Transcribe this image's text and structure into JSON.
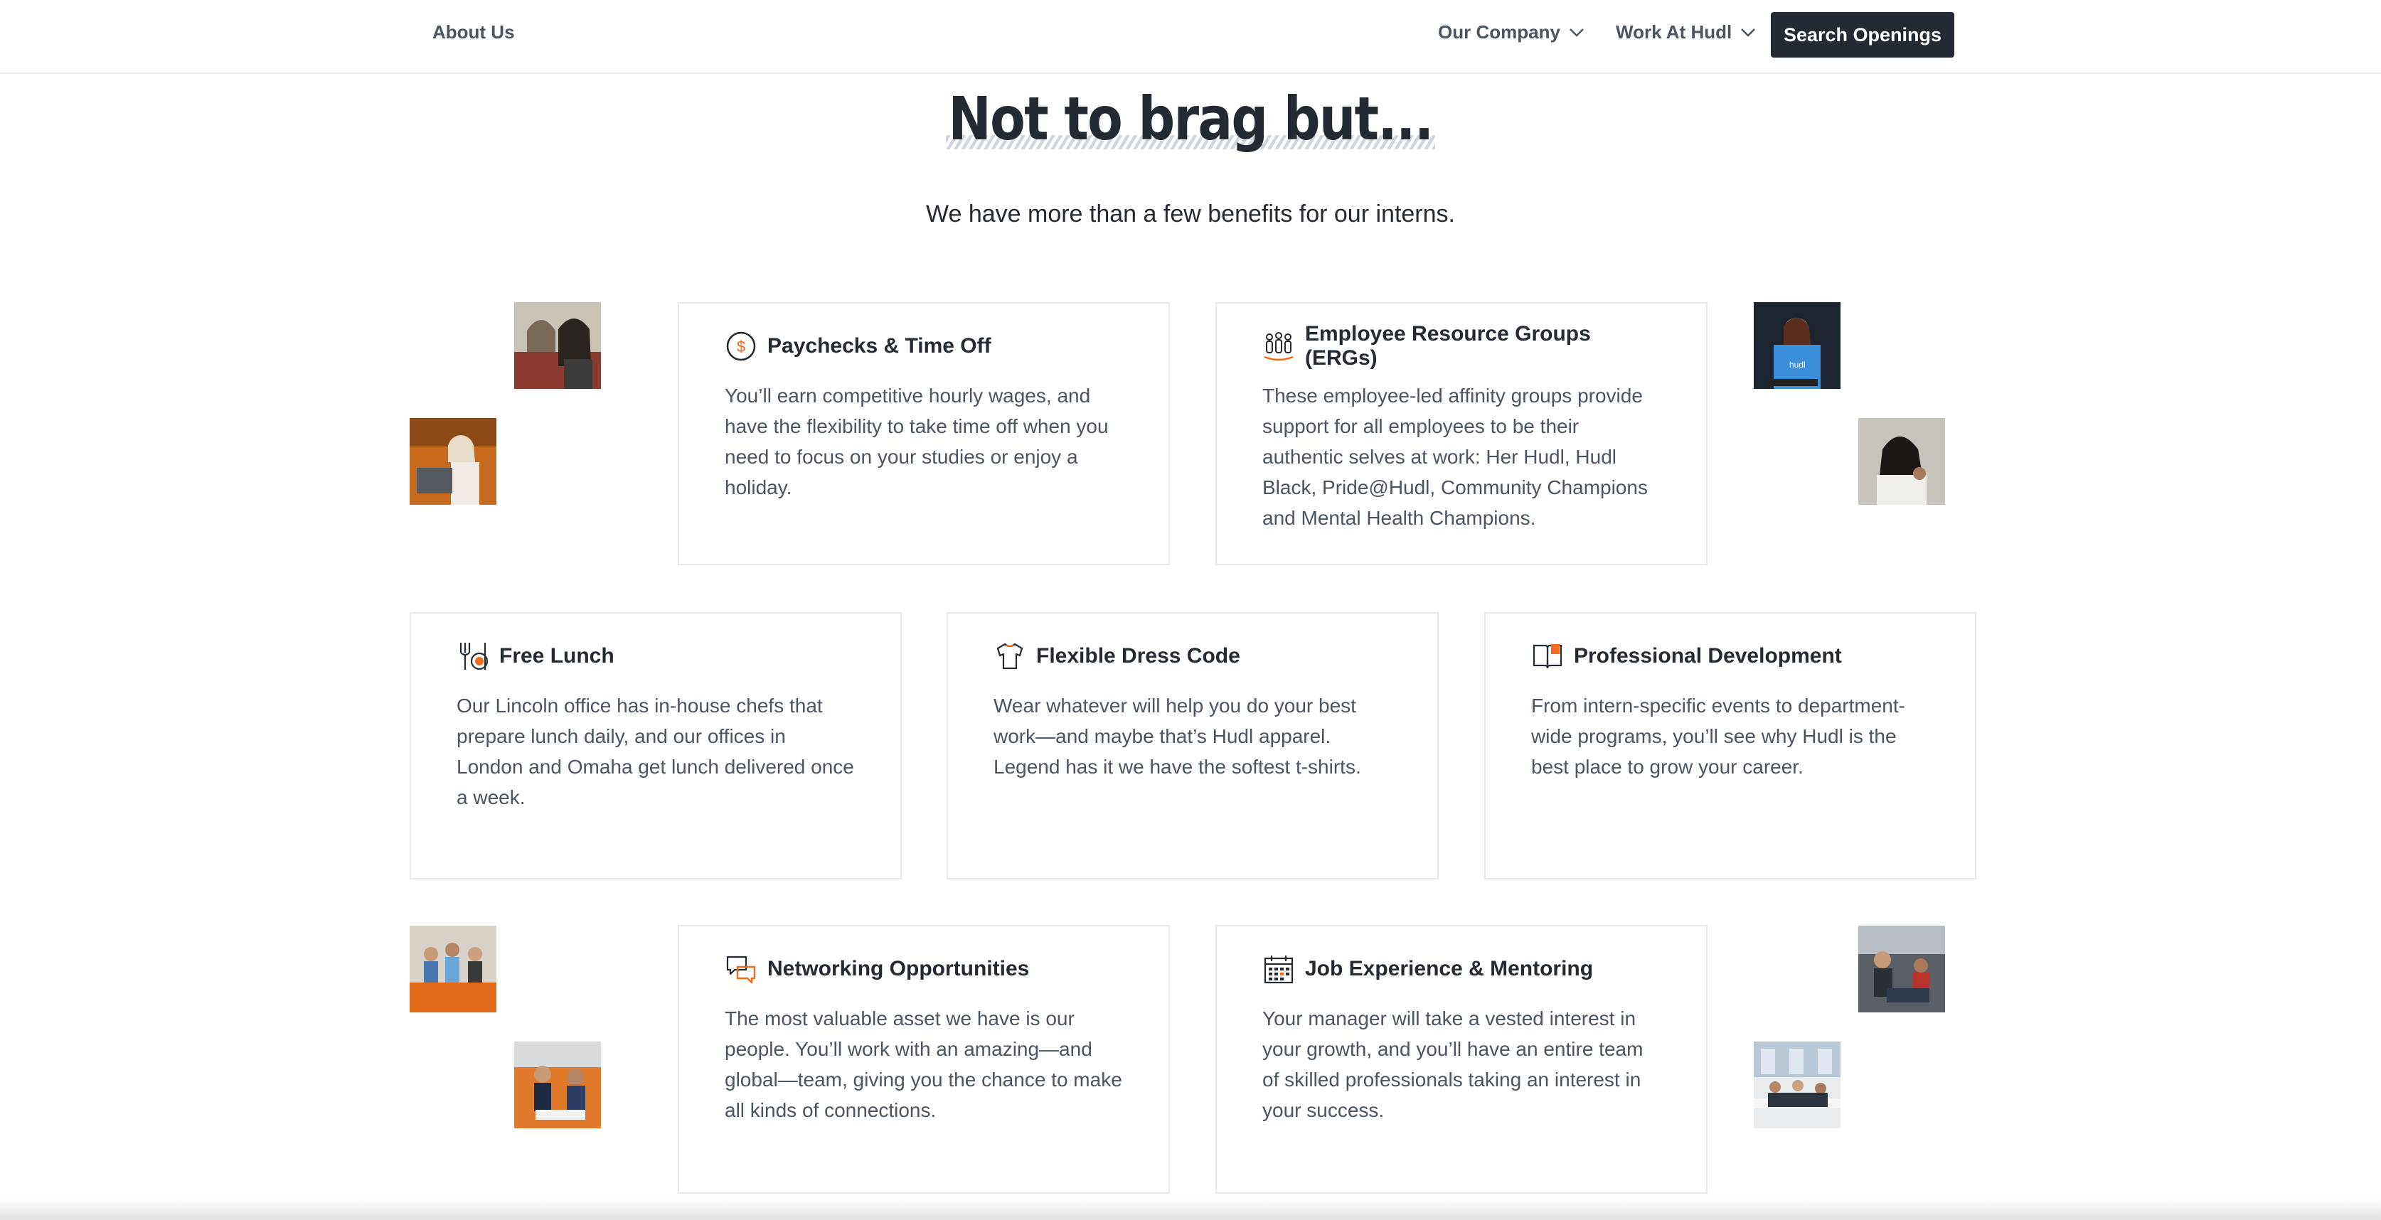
{
  "nav": {
    "about": "About Us",
    "company": "Our Company",
    "work": "Work At Hudl",
    "search_button": "Search Openings"
  },
  "hero": {
    "title": "Not to brag but...",
    "subtitle": "We have more than a few benefits for our interns."
  },
  "benefits": [
    {
      "title": "Paychecks & Time Off",
      "icon": "dollar-coin-icon",
      "text": "You’ll earn competitive hourly wages, and have the flexibility to take time off when you need to focus on your studies or enjoy a holiday."
    },
    {
      "title": "Employee Resource Groups (ERGs)",
      "icon": "people-group-icon",
      "text": "These employee-led affinity groups provide support for all employees to be their authentic selves at work: Her Hudl, Hudl Black, Pride@Hudl, Community Champions and Mental Health Champions."
    },
    {
      "title": "Free Lunch",
      "icon": "fork-knife-icon",
      "text": "Our Lincoln office has in-house chefs that prepare lunch daily, and our offices in London and Omaha get lunch delivered once a week."
    },
    {
      "title": "Flexible Dress Code",
      "icon": "t-shirt-icon",
      "text": "Wear whatever will help you do your best work—and maybe that’s Hudl apparel. Legend has it we have the softest t-shirts."
    },
    {
      "title": "Professional Development",
      "icon": "book-icon",
      "text": "From intern-specific events to department-wide programs, you’ll see why Hudl is the best place to grow your career."
    },
    {
      "title": "Networking Opportunities",
      "icon": "chat-bubbles-icon",
      "text": "The most valuable asset we have is our people. You’ll work with an amazing—and global—team, giving you the chance to make all kinds of connections."
    },
    {
      "title": "Job Experience & Mentoring",
      "icon": "calendar-icon",
      "text": "Your manager will take a vested interest in your growth, and you’ll have an entire team of skilled professionals taking an interest in your success."
    }
  ],
  "colors": {
    "accent": "#f26b1d",
    "dark": "#232a31",
    "body_text": "#4a5561",
    "border": "#e6e9ec"
  }
}
